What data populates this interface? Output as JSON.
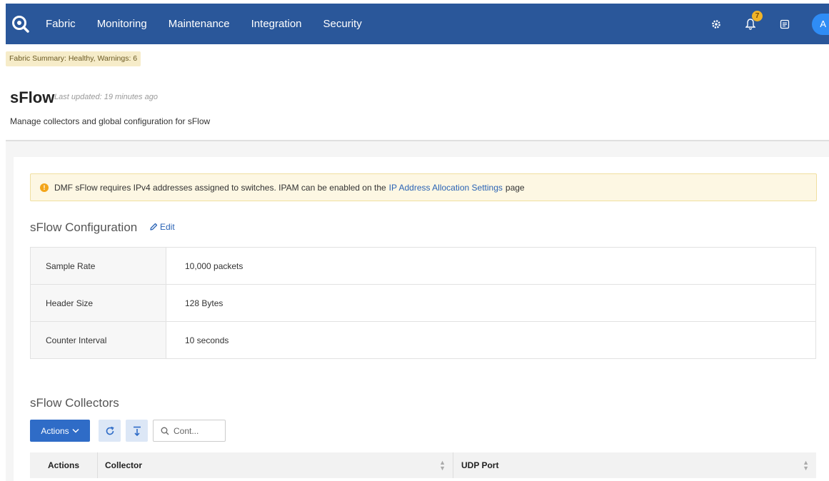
{
  "nav": {
    "items": [
      "Fabric",
      "Monitoring",
      "Maintenance",
      "Integration",
      "Security"
    ],
    "notification_count": "7",
    "avatar_initial": "A"
  },
  "summary": "Fabric Summary: Healthy, Warnings: 6",
  "page": {
    "title": "sFlow",
    "last_updated": "Last updated: 19 minutes ago",
    "description": "Manage collectors and global configuration for sFlow"
  },
  "alert": {
    "text_before": "DMF sFlow requires IPv4 addresses assigned to switches. IPAM can be enabled on the",
    "link": "IP Address Allocation Settings",
    "text_after": "page"
  },
  "config": {
    "title": "sFlow Configuration",
    "edit_label": "Edit",
    "rows": [
      {
        "label": "Sample Rate",
        "value": "10,000 packets"
      },
      {
        "label": "Header Size",
        "value": "128 Bytes"
      },
      {
        "label": "Counter Interval",
        "value": "10 seconds"
      }
    ]
  },
  "collectors": {
    "title": "sFlow Collectors",
    "actions_label": "Actions",
    "search_placeholder": "Cont...",
    "columns": [
      "Actions",
      "Collector",
      "UDP Port"
    ]
  },
  "colors": {
    "nav_bg": "#2a579a",
    "primary": "#2f6cc7",
    "link": "#2a63b5",
    "warning": "#f3a51a"
  }
}
